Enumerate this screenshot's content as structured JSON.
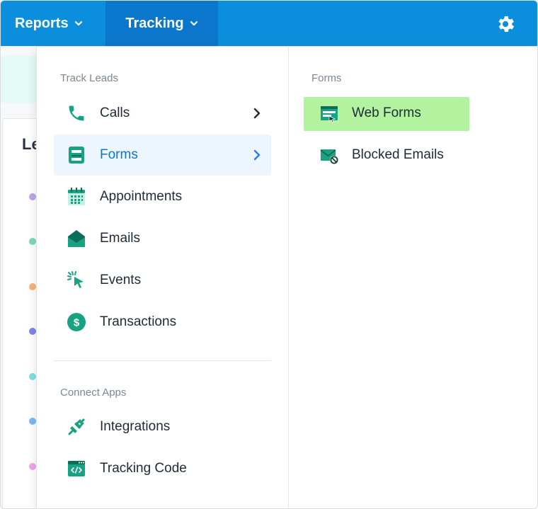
{
  "nav": {
    "reports_label": "Reports",
    "tracking_label": "Tracking",
    "bar_color": "#0b8fdc",
    "active_color": "#0a76cc"
  },
  "background": {
    "card_title": "Le"
  },
  "menu": {
    "track_leads_label": "Track Leads",
    "connect_apps_label": "Connect Apps",
    "items": [
      {
        "label": "Calls",
        "icon": "phone-icon"
      },
      {
        "label": "Forms",
        "icon": "form-icon"
      },
      {
        "label": "Appointments",
        "icon": "calendar-icon"
      },
      {
        "label": "Emails",
        "icon": "envelope-open-icon"
      },
      {
        "label": "Events",
        "icon": "cursor-click-icon"
      },
      {
        "label": "Transactions",
        "icon": "dollar-icon"
      }
    ],
    "apps": [
      {
        "label": "Integrations",
        "icon": "plug-icon"
      },
      {
        "label": "Tracking Code",
        "icon": "code-window-icon"
      }
    ]
  },
  "submenu": {
    "section_label": "Forms",
    "items": [
      {
        "label": "Web Forms",
        "icon": "web-form-icon",
        "highlighted": true
      },
      {
        "label": "Blocked Emails",
        "icon": "blocked-email-icon",
        "highlighted": false
      }
    ]
  },
  "colors": {
    "icon_green": "#17a383",
    "icon_dark": "#0b6e58",
    "highlight": "#b3f3a0",
    "active_bg": "#edf5ff"
  }
}
